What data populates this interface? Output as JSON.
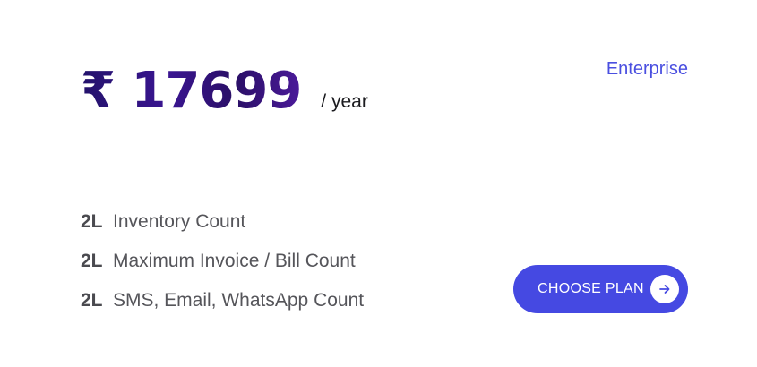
{
  "pricing": {
    "amount": "₹ 17699",
    "period": "/ year",
    "plan_name": "Enterprise"
  },
  "features": [
    {
      "qty": "2L",
      "label": "Inventory Count"
    },
    {
      "qty": "2L",
      "label": "Maximum Invoice / Bill Count"
    },
    {
      "qty": "2L",
      "label": "SMS, Email, WhatsApp Count"
    }
  ],
  "cta": {
    "label": "CHOOSE PLAN",
    "icon": "arrow-right-icon"
  },
  "colors": {
    "accent": "#4549e2",
    "price_gradient_start": "#23126b",
    "price_gradient_end": "#4b1a9a"
  }
}
